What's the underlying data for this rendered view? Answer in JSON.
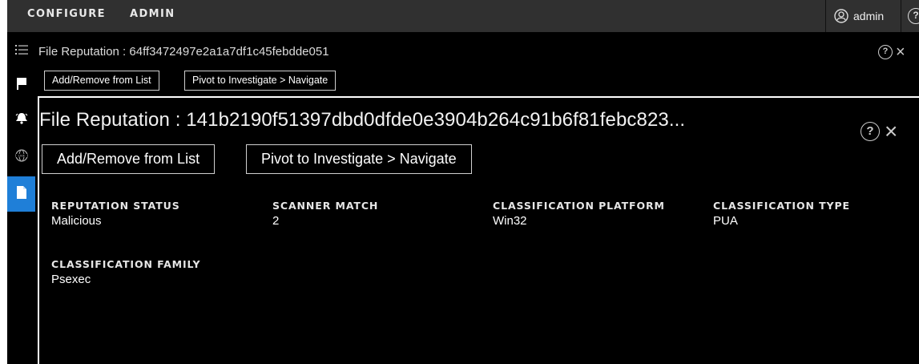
{
  "topnav": {
    "items": [
      {
        "label": "CONFIGURE"
      },
      {
        "label": "ADMIN"
      }
    ],
    "user": {
      "name": "admin",
      "icon": "user-icon"
    },
    "help_icon": "help-icon"
  },
  "sidebar": {
    "items": [
      {
        "icon": "list-icon"
      },
      {
        "icon": "flag-icon"
      },
      {
        "icon": "alarm-icon"
      },
      {
        "icon": "live-globe-icon"
      },
      {
        "icon": "file-icon",
        "active": true
      }
    ],
    "active_color": "#1f7fd8"
  },
  "back_panel": {
    "title": "File Reputation : 64ff3472497e2a1a7df1c45febdde051",
    "help_label": "?",
    "close_label": "×",
    "buttons": {
      "add_remove": "Add/Remove from List",
      "pivot": "Pivot to Investigate > Navigate"
    }
  },
  "front_panel": {
    "title": "File Reputation : 141b2190f51397dbd0dfde0e3904b264c91b6f81febc823...",
    "help_label": "?",
    "close_label": "×",
    "buttons": {
      "add_remove": "Add/Remove from List",
      "pivot": "Pivot to Investigate > Navigate"
    },
    "fields": {
      "reputation_status": {
        "label": "REPUTATION STATUS",
        "value": "Malicious"
      },
      "scanner_match": {
        "label": "SCANNER MATCH",
        "value": "2"
      },
      "classification_platform": {
        "label": "CLASSIFICATION PLATFORM",
        "value": "Win32"
      },
      "classification_type": {
        "label": "CLASSIFICATION TYPE",
        "value": "PUA"
      },
      "classification_family": {
        "label": "CLASSIFICATION FAMILY",
        "value": "Psexec"
      }
    }
  }
}
